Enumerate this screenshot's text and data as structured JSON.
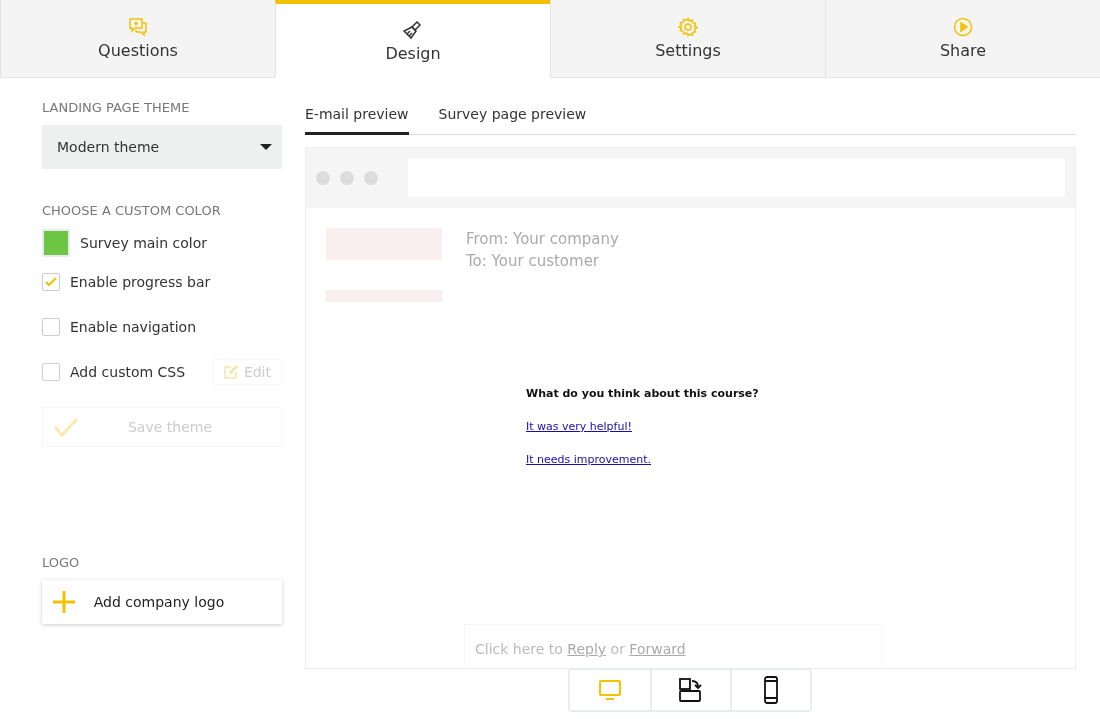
{
  "tabs": [
    {
      "label": "Questions",
      "kind": "chat",
      "selected": false
    },
    {
      "label": "Design",
      "kind": "brush",
      "selected": true
    },
    {
      "label": "Settings",
      "kind": "gear",
      "selected": false
    },
    {
      "label": "Share",
      "kind": "play",
      "selected": false
    }
  ],
  "sidebar": {
    "theme_heading": "LANDING PAGE THEME",
    "theme_value": "Modern theme",
    "color_heading": "CHOOSE A CUSTOM COLOR",
    "main_color": {
      "label": "Survey main color",
      "color": "#6cc644"
    },
    "options": [
      {
        "label": "Enable progress bar",
        "checked": true
      },
      {
        "label": "Enable navigation",
        "checked": false
      },
      {
        "label": "Add custom CSS",
        "checked": false,
        "edit_label": "Edit"
      }
    ],
    "save_button": {
      "label": "Save theme",
      "disabled": true
    },
    "logo_heading": "LOGO",
    "logo_button": "Add company logo"
  },
  "preview_tabs": [
    {
      "label": "E-mail preview",
      "selected": true
    },
    {
      "label": "Survey page preview",
      "selected": false
    }
  ],
  "email": {
    "from": "From: Your company",
    "to": "To: Your customer",
    "question": "What do you think about this course?",
    "answers": [
      "It was very helpful!",
      "It needs improvement."
    ],
    "reply": {
      "prefix": "Click here to",
      "reply": "Reply",
      "middle": "or",
      "forward": "Forward"
    }
  },
  "devices": [
    {
      "kind": "desktop",
      "selected": true
    },
    {
      "kind": "rotate",
      "selected": false
    },
    {
      "kind": "phone",
      "selected": false
    }
  ]
}
